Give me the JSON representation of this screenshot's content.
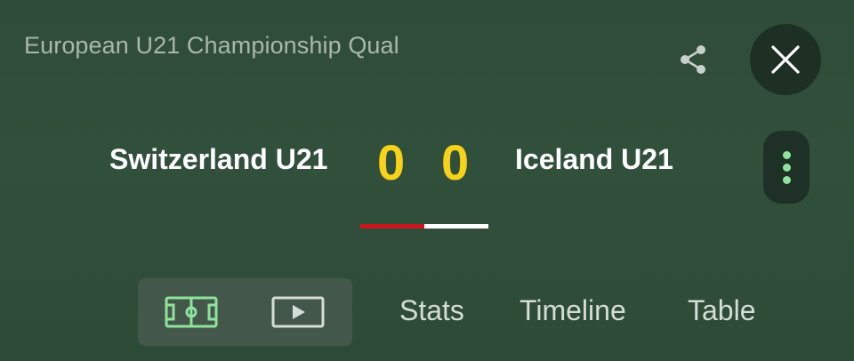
{
  "header": {
    "competition": "European U21 Championship Qual",
    "share_icon": "share-icon",
    "close_icon": "close-icon"
  },
  "match": {
    "home_team": "Switzerland U21",
    "away_team": "Iceland U21",
    "home_score": "0",
    "away_score": "0",
    "possession": {
      "home_fraction": 0.5,
      "away_fraction": 0.5,
      "home_color": "#c8161d",
      "away_color": "#ffffff"
    },
    "score_color": "#f7d21a",
    "more_icon": "more-vertical-icon"
  },
  "tabs": {
    "icon_tabs": [
      {
        "icon": "pitch-icon",
        "accent": "#8fe39c"
      },
      {
        "icon": "video-play-icon",
        "accent": "#d5ddd7"
      }
    ],
    "items": [
      {
        "label": "Stats"
      },
      {
        "label": "Timeline"
      },
      {
        "label": "Table"
      }
    ]
  }
}
